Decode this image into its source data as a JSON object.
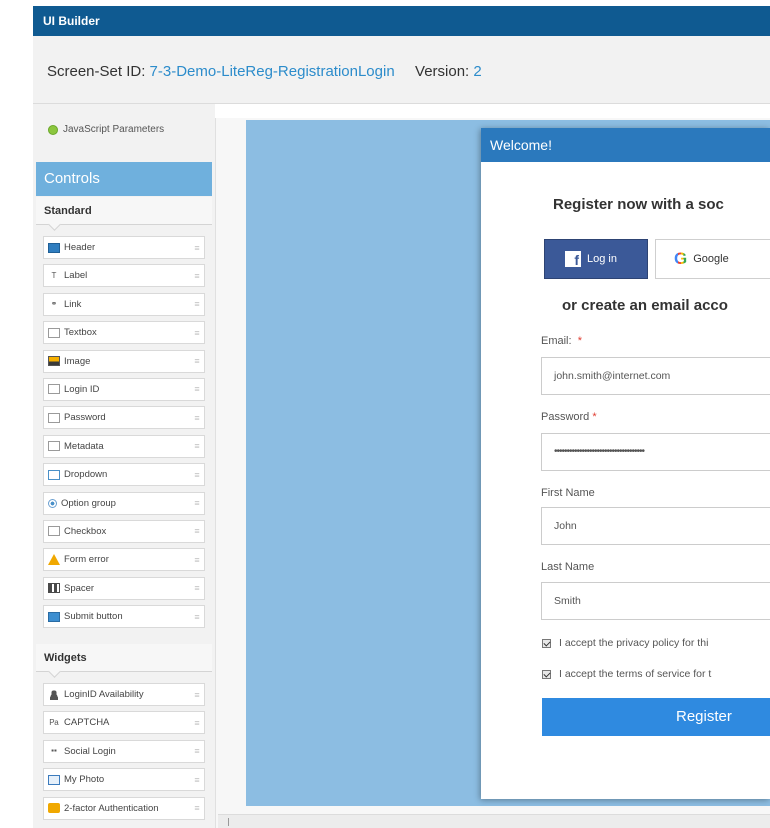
{
  "app": {
    "title": "UI Builder"
  },
  "header": {
    "screenset_label": "Screen-Set ID:",
    "screenset_id": "7-3-Demo-LiteReg-RegistrationLogin",
    "version_label": "Version:",
    "version_value": "2"
  },
  "left_panel": {
    "js_params_label": "JavaScript Parameters",
    "controls_title": "Controls",
    "standard_title": "Standard",
    "standard_items": [
      {
        "label": "Header",
        "icon": "header-icon"
      },
      {
        "label": "Label",
        "icon": "label-icon"
      },
      {
        "label": "Link",
        "icon": "link-icon"
      },
      {
        "label": "Textbox",
        "icon": "textbox-icon"
      },
      {
        "label": "Image",
        "icon": "image-icon"
      },
      {
        "label": "Login ID",
        "icon": "login-id-icon"
      },
      {
        "label": "Password",
        "icon": "password-icon"
      },
      {
        "label": "Metadata",
        "icon": "metadata-icon"
      },
      {
        "label": "Dropdown",
        "icon": "dropdown-icon"
      },
      {
        "label": "Option group",
        "icon": "radio-icon"
      },
      {
        "label": "Checkbox",
        "icon": "checkbox-icon"
      },
      {
        "label": "Form error",
        "icon": "warning-icon"
      },
      {
        "label": "Spacer",
        "icon": "spacer-icon"
      },
      {
        "label": "Submit button",
        "icon": "submit-icon"
      }
    ],
    "widgets_title": "Widgets",
    "widget_items": [
      {
        "label": "LoginID Availability",
        "icon": "person-icon"
      },
      {
        "label": "CAPTCHA",
        "icon": "captcha-icon"
      },
      {
        "label": "Social Login",
        "icon": "social-icon"
      },
      {
        "label": "My Photo",
        "icon": "photo-icon"
      },
      {
        "label": "2-factor Authentication",
        "icon": "lock-icon"
      }
    ],
    "handle_glyph": "≡"
  },
  "dialog": {
    "title": "Welcome!",
    "heading": "Register now with a soc",
    "facebook_label": "Log in",
    "facebook_glyph": "f",
    "google_glyph": "G",
    "google_label": "Google",
    "or_text": "or create an email acco",
    "email_label": "Email:",
    "email_value": "john.smith@internet.com",
    "password_label": "Password",
    "password_value": "••••••••••••••••••••••••••••••••••••",
    "required_mark": "*",
    "first_name_label": "First Name",
    "first_name_value": "John",
    "last_name_label": "Last Name",
    "last_name_value": "Smith",
    "privacy_text": "I accept the privacy policy for thi",
    "terms_text": "I accept the terms of service for t",
    "register_label": "Register"
  },
  "colors": {
    "title_bar": "#0f5a91",
    "link_blue": "#2c8ccb",
    "controls_header": "#6fb0dd",
    "canvas_blue": "#8cbde2",
    "dialog_title": "#2b79bd",
    "facebook": "#3b5998",
    "register_button": "#2f8ae0"
  }
}
